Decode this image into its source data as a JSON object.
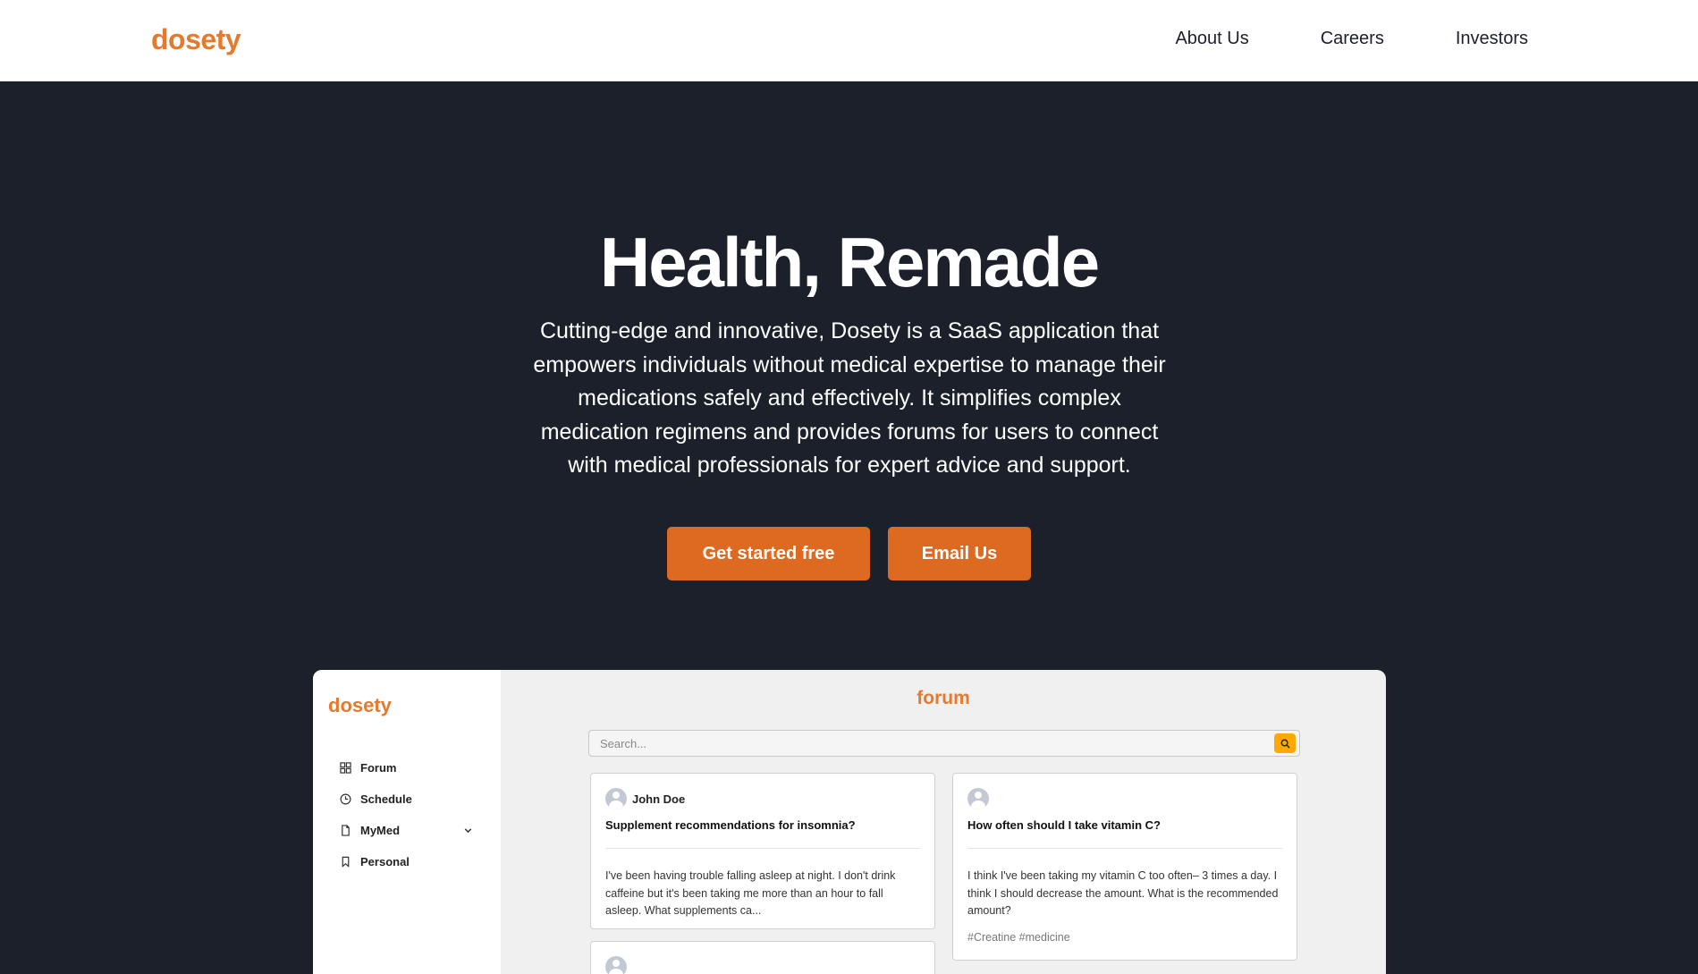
{
  "header": {
    "logo": "dosety",
    "nav": [
      "About Us",
      "Careers",
      "Investors"
    ]
  },
  "hero": {
    "title": "Health, Remade",
    "description": "Cutting-edge and innovative, Dosety is a SaaS application that empowers individuals without medical expertise to manage their medications safely and effectively. It simplifies complex medication regimens and provides forums for users to connect with medical professionals for expert advice and support.",
    "cta_primary": "Get started free",
    "cta_secondary": "Email Us"
  },
  "preview": {
    "logo": "dosety",
    "menu": [
      {
        "label": "Forum",
        "icon": "grid-icon"
      },
      {
        "label": "Schedule",
        "icon": "clock-icon"
      },
      {
        "label": "MyMed",
        "icon": "file-icon"
      },
      {
        "label": "Personal",
        "icon": "bookmark-icon"
      }
    ],
    "title": "forum",
    "search_placeholder": "Search...",
    "posts": [
      {
        "author": "John Doe",
        "question": "Supplement recommendations for insomnia?",
        "body": "I've been having trouble falling asleep at night. I don't drink caffeine but it's been taking me more than an hour to fall asleep. What supplements ca..."
      },
      {
        "author": "",
        "question": "How often should I take vitamin C?",
        "body": "I think I've been taking my vitamin C too often– 3 times a day. I think I should decrease the amount. What is the recommended amount?",
        "tags": "#Creatine #medicine"
      }
    ]
  },
  "colors": {
    "brand_orange": "#e37a2e",
    "button_orange": "#de6a22",
    "hero_bg": "#1b202b",
    "search_button": "#ffa800"
  }
}
